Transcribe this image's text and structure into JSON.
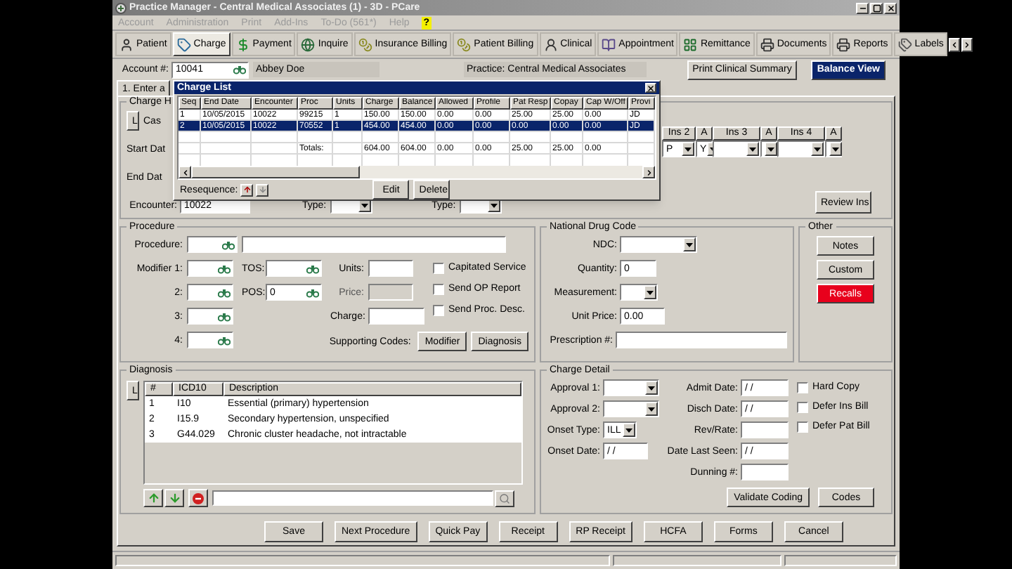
{
  "window": {
    "title": "Practice Manager - Central Medical Associates (1) - 3D - PCare"
  },
  "menu": [
    {
      "label": "Account",
      "kind": "item"
    },
    {
      "label": "Administration",
      "kind": "item"
    },
    {
      "label": "Print",
      "kind": "item"
    },
    {
      "label": "Add-Ins",
      "kind": "item"
    },
    {
      "label": "To-Do (561*)",
      "kind": "item"
    },
    {
      "label": "Help",
      "kind": "item"
    },
    {
      "label": "?",
      "kind": "highlight"
    }
  ],
  "toolbar": [
    {
      "label": "Patient",
      "selected": false
    },
    {
      "label": "Charge",
      "selected": true
    },
    {
      "label": "Payment",
      "selected": false
    },
    {
      "label": "Inquire",
      "selected": false
    },
    {
      "label": "Insurance Billing",
      "selected": false
    },
    {
      "label": "Patient Billing",
      "selected": false
    },
    {
      "label": "Clinical",
      "selected": false
    },
    {
      "label": "Appointment",
      "selected": false
    },
    {
      "label": "Remittance",
      "selected": false
    },
    {
      "label": "Documents",
      "selected": false
    },
    {
      "label": "Reports",
      "selected": false
    },
    {
      "label": "Labels",
      "selected": false
    }
  ],
  "account": {
    "label": "Account #:",
    "value": "10041",
    "patient": "Abbey Doe",
    "practice": "Practice: Central Medical Associates"
  },
  "top_buttons": [
    {
      "label": "Print Clinical Summary",
      "selected": false
    },
    {
      "label": "Balance View",
      "selected": true
    }
  ],
  "entry_tab": {
    "label": "1. Enter a",
    "selected": true
  },
  "charge_header": {
    "title": "Charge H",
    "l_button": "L",
    "case_label": "Cas",
    "start_label": "Start Dat",
    "end_label": "End Dat",
    "encounter_label": "Encounter:",
    "encounter": "10022",
    "type_labels": [
      "Type:",
      "Type:"
    ],
    "insurance": [
      {
        "header": "Ins 2",
        "value": "P"
      },
      {
        "header": "A",
        "value": "Y"
      },
      {
        "header": "Ins 3"
      },
      {
        "header": "A"
      },
      {
        "header": "Ins 4"
      },
      {
        "header": "A"
      }
    ],
    "review_button": "Review Ins"
  },
  "charge_list": {
    "title": "Charge List",
    "columns": [
      "Seq",
      "End Date",
      "Encounter",
      "Proc",
      "Units",
      "Charge",
      "Balance",
      "Allowed",
      "Profile",
      "Pat Resp",
      "Copay",
      "Cap W/Off",
      "Provi"
    ],
    "rows": [
      {
        "cells": [
          "1",
          "10/05/2015",
          "10022",
          "99215",
          "1",
          "150.00",
          "150.00",
          "0.00",
          "0.00",
          "25.00",
          "25.00",
          "0.00",
          "JD"
        ],
        "selected": false
      },
      {
        "cells": [
          "2",
          "10/05/2015",
          "10022",
          "70552",
          "1",
          "454.00",
          "454.00",
          "0.00",
          "0.00",
          "0.00",
          "0.00",
          "0.00",
          "JD"
        ],
        "selected": true
      }
    ],
    "totals_label": "Totals:",
    "totals": [
      "604.00",
      "604.00",
      "0.00",
      "0.00",
      "25.00",
      "25.00",
      "0.00"
    ],
    "resequence_label": "Resequence:",
    "buttons": [
      "Edit",
      "Delete"
    ]
  },
  "procedure": {
    "title": "Procedure",
    "procedure_label": "Procedure:",
    "modifiers": [
      "Modifier 1:",
      "2:",
      "3:",
      "4:"
    ],
    "tos_label": "TOS:",
    "pos_label": "POS:",
    "pos_value": "0",
    "units_label": "Units:",
    "price_label": "Price:",
    "charge_label": "Charge:",
    "options": [
      {
        "label": "Capitated Service",
        "checked": false
      },
      {
        "label": "Send OP Report",
        "checked": false
      },
      {
        "label": "Send Proc. Desc.",
        "checked": false
      }
    ],
    "supporting_label": "Supporting Codes:",
    "supporting_buttons": [
      "Modifier",
      "Diagnosis"
    ]
  },
  "ndc": {
    "title": "National Drug Code",
    "ndc_label": "NDC:",
    "quantity_label": "Quantity:",
    "quantity": "0",
    "measurement_label": "Measurement:",
    "unit_price_label": "Unit Price:",
    "unit_price": "0.00",
    "prescription_label": "Prescription #:"
  },
  "other": {
    "title": "Other",
    "buttons": [
      {
        "label": "Notes",
        "color": "#d4d0c8"
      },
      {
        "label": "Custom",
        "color": "#d4d0c8"
      },
      {
        "label": "Recalls",
        "color": "#e8001c"
      }
    ]
  },
  "diagnosis": {
    "title": "Diagnosis",
    "l_button": "L",
    "columns": [
      "#",
      "ICD10",
      "Description"
    ],
    "rows": [
      {
        "cells": [
          "1",
          "I10",
          "Essential (primary) hypertension"
        ]
      },
      {
        "cells": [
          "2",
          "I15.9",
          "Secondary hypertension, unspecified"
        ]
      },
      {
        "cells": [
          "3",
          "G44.029",
          "Chronic cluster headache, not intractable"
        ]
      }
    ]
  },
  "charge_detail": {
    "title": "Charge Detail",
    "approval_labels": [
      "Approval 1:",
      "Approval 2:"
    ],
    "onset_type_label": "Onset Type:",
    "onset_type": "ILL",
    "onset_date_label": "Onset Date:",
    "onset_date": "/ /",
    "dates": [
      {
        "label": "Admit Date:",
        "value": "/ /"
      },
      {
        "label": "Disch Date:",
        "value": "/ /"
      },
      {
        "label": "Rev/Rate:"
      },
      {
        "label": "Date Last Seen:",
        "value": "/ /"
      },
      {
        "label": "Dunning #:"
      }
    ],
    "options": [
      {
        "label": "Hard Copy",
        "checked": false
      },
      {
        "label": "Defer Ins Bill",
        "checked": false
      },
      {
        "label": "Defer Pat Bill",
        "checked": false
      }
    ],
    "buttons": [
      "Validate Coding",
      "Codes"
    ]
  },
  "actions": [
    "Save",
    "Next Procedure",
    "Quick Pay",
    "Receipt",
    "RP Receipt",
    "HCFA",
    "Forms",
    "Cancel"
  ]
}
